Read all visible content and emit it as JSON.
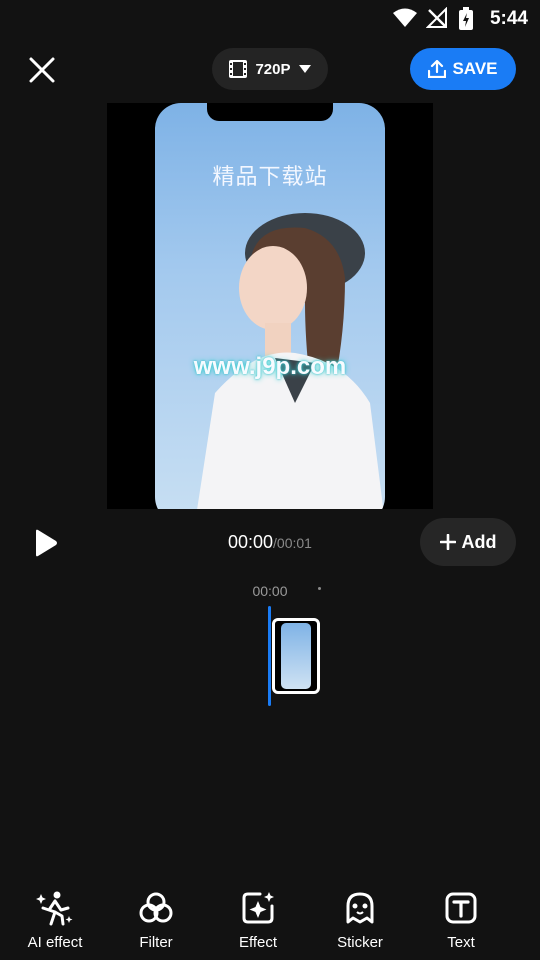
{
  "status_bar": {
    "time": "5:44"
  },
  "toolbar": {
    "resolution": "720P",
    "save_label": "SAVE"
  },
  "preview": {
    "overlay_title": "精品下载站",
    "overlay_url": "www.j9p.com"
  },
  "playback": {
    "current_time": "00:00",
    "total_time": "/00:01",
    "add_label": "Add"
  },
  "timeline": {
    "ruler_time": "00:00"
  },
  "bottom_tools": [
    {
      "label": "AI effect",
      "icon": "ai-effect-icon"
    },
    {
      "label": "Filter",
      "icon": "filter-icon"
    },
    {
      "label": "Effect",
      "icon": "effect-icon"
    },
    {
      "label": "Sticker",
      "icon": "sticker-icon"
    },
    {
      "label": "Text",
      "icon": "text-icon"
    }
  ],
  "colors": {
    "accent": "#1a7cf5",
    "background": "#121212"
  }
}
